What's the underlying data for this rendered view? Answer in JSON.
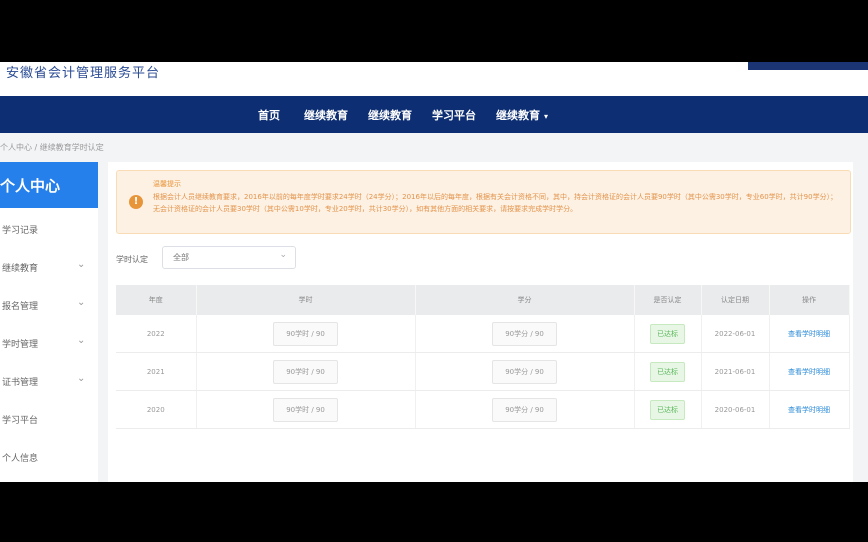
{
  "site": {
    "title": "安徽省会计管理服务平台"
  },
  "nav": {
    "items": [
      {
        "label": "首页"
      },
      {
        "label": "继续教育"
      },
      {
        "label": "继续教育"
      },
      {
        "label": "学习平台"
      },
      {
        "label": "继续教育"
      }
    ]
  },
  "breadcrumb": {
    "home": "个人中心",
    "separator": "/",
    "current": "继续教育学时认定"
  },
  "sidebar": {
    "header": "个人中心",
    "items": [
      {
        "label": "学习记录",
        "has_arrow": false
      },
      {
        "label": "继续教育",
        "has_arrow": true
      },
      {
        "label": "报名管理",
        "has_arrow": true
      },
      {
        "label": "学时管理",
        "has_arrow": true
      },
      {
        "label": "证书管理",
        "has_arrow": true
      },
      {
        "label": "学习平台",
        "has_arrow": false
      },
      {
        "label": "个人信息",
        "has_arrow": false
      }
    ]
  },
  "notice": {
    "icon": "warning-icon",
    "title": "温馨提示",
    "text": "根据会计人员继续教育要求，2016年以前的每年度学时要求24学时（24学分）；2016年以后的每年度，根据有关会计资格不同，其中，持会计资格证的会计人员要90学时（其中公需30学时，专业60学时，共计90学分）；无会计资格证的会计人员要30学时（其中公需10学时，专业20学时，共计30学分），如有其他方面的相关要求，请按要求完成学时学分。"
  },
  "filter": {
    "label": "学时认定",
    "value": "全部"
  },
  "table": {
    "headers": [
      "年度",
      "学时",
      "学分",
      "是否认定",
      "认定日期",
      "操作"
    ],
    "rows": [
      {
        "year": "2022",
        "hours": "90学时 / 90",
        "credits": "90学分 / 90",
        "status": "已达标",
        "date": "2022-06-01",
        "action": "查看学时明细"
      },
      {
        "year": "2021",
        "hours": "90学时 / 90",
        "credits": "90学分 / 90",
        "status": "已达标",
        "date": "2021-06-01",
        "action": "查看学时明细"
      },
      {
        "year": "2020",
        "hours": "90学时 / 90",
        "credits": "90学分 / 90",
        "status": "已达标",
        "date": "2020-06-01",
        "action": "查看学时明细"
      }
    ]
  },
  "colors": {
    "nav_bg": "#0d2e73",
    "sidebar_active": "#2680eb",
    "notice_bg": "#fdf1e4",
    "notice_text": "#e3944b",
    "status_green": "#5cb85c",
    "link_blue": "#2a8bd8"
  }
}
